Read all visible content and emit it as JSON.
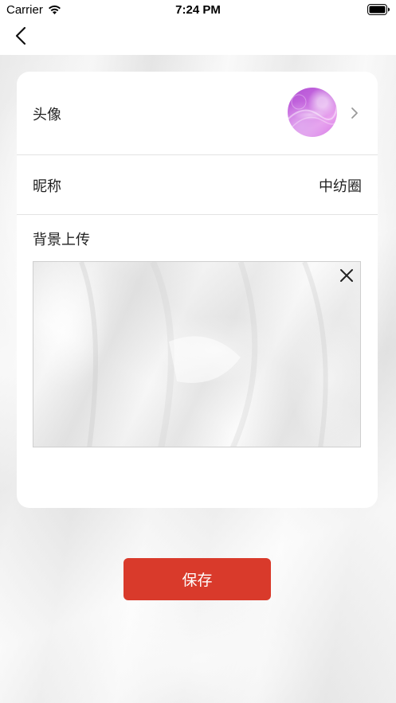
{
  "status_bar": {
    "carrier": "Carrier",
    "time": "7:24 PM",
    "icons": [
      "wifi-icon",
      "battery-icon"
    ]
  },
  "nav": {
    "back_icon": "chevron-left-icon"
  },
  "profile": {
    "avatar_label": "头像",
    "avatar_icon": "chevron-right-icon",
    "nickname_label": "昵称",
    "nickname_value": "中纺圈",
    "background_label": "背景上传",
    "remove_icon": "close-icon"
  },
  "actions": {
    "save_label": "保存"
  },
  "colors": {
    "accent": "#d93a2b",
    "card": "#ffffff",
    "divider": "#e3e3e3"
  }
}
